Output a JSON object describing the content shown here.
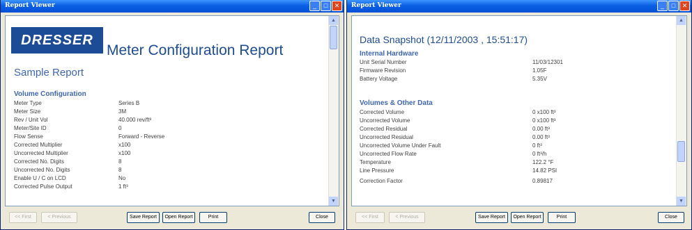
{
  "left_window": {
    "title": "Report Viewer",
    "title_buttons": [
      "_",
      "□",
      "✕"
    ],
    "logo": "DRESSER",
    "report_title": "Meter Configuration Report",
    "sample_title": "Sample Report",
    "section_title": "Volume Configuration",
    "rows": [
      {
        "label": "Meter Type",
        "value": "Series B"
      },
      {
        "label": "Meter Size",
        "value": "3M"
      },
      {
        "label": "Rev / Unit Vol",
        "value": "40.000 rev/ft³"
      },
      {
        "label": "Meter/Site ID",
        "value": "0"
      },
      {
        "label": "Flow Sense",
        "value": "Forward - Reverse"
      },
      {
        "label": "Corrected Multiplier",
        "value": "x100"
      },
      {
        "label": "Uncorrected Multiplier",
        "value": "x100"
      },
      {
        "label": "Corrected No. Digits",
        "value": "8"
      },
      {
        "label": "Uncorrected No. Digits",
        "value": "8"
      },
      {
        "label": "Enable U / C on LCD",
        "value": "No"
      },
      {
        "label": "Corrected Pulse Output",
        "value": "1 ft³"
      }
    ],
    "buttons": {
      "first": "<< First",
      "previous": "< Previous",
      "save": "Save Report",
      "open": "Open Report",
      "print": "Print",
      "close": "Close"
    }
  },
  "right_window": {
    "title": "Report Viewer",
    "title_buttons": [
      "_",
      "□",
      "✕"
    ],
    "snapshot_title": "Data Snapshot (12/11/2003 , 15:51:17)",
    "hardware_title": "Internal Hardware",
    "hardware_rows": [
      {
        "label": "Unit Serial Number",
        "value": "11/03/12301"
      },
      {
        "label": "Firmware Revision",
        "value": "1.05F"
      },
      {
        "label": "Battery Voltage",
        "value": "5.35V"
      }
    ],
    "volumes_title": "Volumes & Other Data",
    "volume_rows": [
      {
        "label": "Corrected Volume",
        "value": "0 x100 ft³"
      },
      {
        "label": "Uncorrected Volume",
        "value": "0 x100 ft³"
      },
      {
        "label": "Corrected Residual",
        "value": "0.00 ft³"
      },
      {
        "label": "Uncorrected Residual",
        "value": "0.00 ft³"
      },
      {
        "label": "Uncorrected Volume Under Fault",
        "value": "0 ft³"
      },
      {
        "label": "Uncorrected Flow Rate",
        "value": "0 ft³/h"
      },
      {
        "label": "Temperature",
        "value": "122.2 °F"
      },
      {
        "label": "Line Pressure",
        "value": "14.82 PSI"
      },
      {
        "label": "Correction Factor",
        "value": "0.89817"
      }
    ],
    "buttons": {
      "first": "<< First",
      "previous": "< Previous",
      "save": "Save Report",
      "open": "Open Report",
      "print": "Print",
      "close": "Close"
    }
  }
}
